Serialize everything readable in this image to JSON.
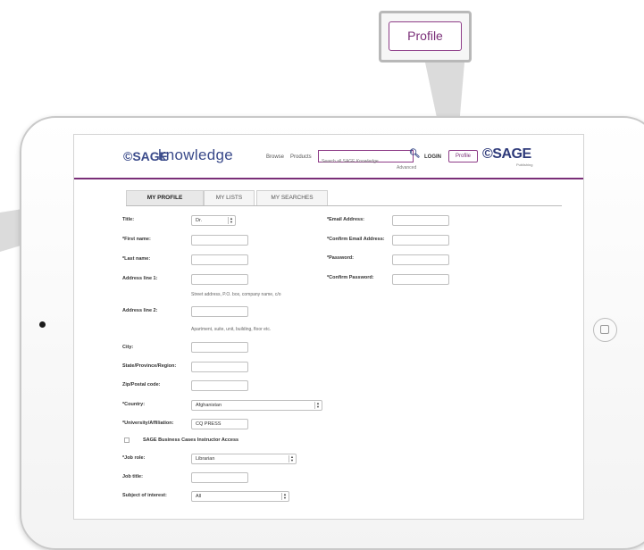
{
  "callout": {
    "profile_label": "Profile"
  },
  "header": {
    "logo_mark": "©SAGE",
    "logo_word": "knowledge",
    "nav": [
      "Browse",
      "Products"
    ],
    "search_placeholder": "Search all SAGE Knowledge",
    "advanced_label": "Advanced",
    "login_label": "LOGIN",
    "profile_label": "Profile",
    "brand_mark": "©SAGE",
    "brand_sub": "Publishing"
  },
  "tabs": [
    {
      "label": "MY PROFILE",
      "active": true
    },
    {
      "label": "MY LISTS",
      "active": false
    },
    {
      "label": "MY SEARCHES",
      "active": false
    }
  ],
  "form": {
    "title": {
      "label": "Title:",
      "value": "Dr."
    },
    "first_name": {
      "label": "*First name:",
      "value": ""
    },
    "last_name": {
      "label": "*Last name:",
      "value": ""
    },
    "address1": {
      "label": "Address line 1:",
      "value": "",
      "hint": "Street address, P.O. box, company name, c/o"
    },
    "address2": {
      "label": "Address line 2:",
      "value": "",
      "hint": "Apartment, suite, unit, building, floor etc."
    },
    "city": {
      "label": "City:",
      "value": ""
    },
    "state": {
      "label": "State/Province/Region:",
      "value": ""
    },
    "zip": {
      "label": "Zip/Postal code:",
      "value": ""
    },
    "country": {
      "label": "*Country:",
      "value": "Afghanistan"
    },
    "university": {
      "label": "*University/Affiliation:",
      "value": "CQ PRESS"
    },
    "sage_cases": {
      "label": "SAGE Business Cases Instructor Access",
      "checked": false
    },
    "job_role": {
      "label": "*Job role:",
      "value": "Librarian"
    },
    "job_title": {
      "label": "Job title:",
      "value": ""
    },
    "subject": {
      "label": "Subject of interest:",
      "value": "All"
    },
    "email": {
      "label": "*Email Address:",
      "value": ""
    },
    "confirm_email": {
      "label": "*Confirm Email Address:",
      "value": ""
    },
    "password": {
      "label": "*Password:",
      "value": ""
    },
    "confirm_password": {
      "label": "*Confirm Password:",
      "value": ""
    }
  }
}
